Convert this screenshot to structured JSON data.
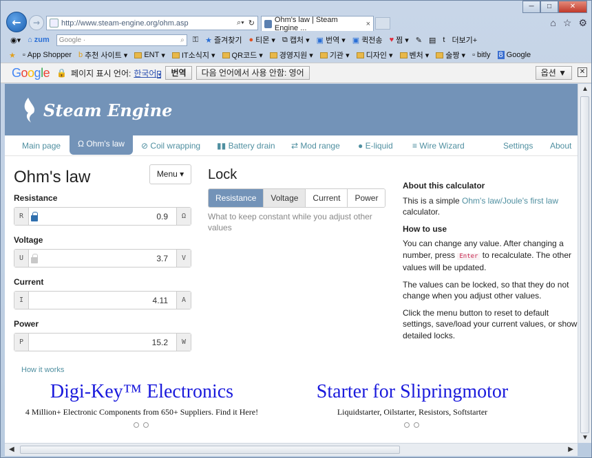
{
  "browser": {
    "url": "http://www.steam-engine.org/ohm.asp",
    "tab_title": "Ohm's law | Steam Engine ...",
    "tab_close": "×",
    "search_placeholder": "Google ·",
    "toolbar1": [
      "zum",
      "즐겨찾기",
      "티몬",
      "캡처",
      "번역",
      "퀵전송",
      "찜",
      "더보기+"
    ],
    "toolbar2": [
      "App Shopper",
      "추천 사이트",
      "ENT",
      "IT소식지",
      "QR코드",
      "경영지원",
      "기관",
      "디자인",
      "벤처",
      "술짱",
      "bitly",
      "Google"
    ]
  },
  "translate_bar": {
    "logo": "Google",
    "page_language_label": "페이지 표시 언어:",
    "page_language": "한국어",
    "translate_button": "번역",
    "never_button": "다음 언어에서 사용 안함: 영어",
    "options_button": "옵션 ▼",
    "close": "✕"
  },
  "site": {
    "brand": "Steam Engine",
    "nav": [
      "Main page",
      "Ohm's law",
      "Coil wrapping",
      "Battery drain",
      "Mod range",
      "E-liquid",
      "Wire Wizard",
      "Settings",
      "About"
    ],
    "nav_icons": [
      "",
      "Ω",
      "⊘",
      "▮▮",
      "⇄",
      "●",
      "≡",
      "",
      ""
    ]
  },
  "calculator": {
    "title": "Ohm's law",
    "menu_label": "Menu ▾",
    "fields": [
      {
        "label": "Resistance",
        "prefix": "R",
        "value": "0.9",
        "unit": "Ω",
        "locked": true
      },
      {
        "label": "Voltage",
        "prefix": "U",
        "value": "3.7",
        "unit": "V",
        "locked": false
      },
      {
        "label": "Current",
        "prefix": "I",
        "value": "4.11",
        "unit": "A",
        "locked": null
      },
      {
        "label": "Power",
        "prefix": "P",
        "value": "15.2",
        "unit": "W",
        "locked": null
      }
    ]
  },
  "lock": {
    "title": "Lock",
    "options": [
      "Resistance",
      "Voltage",
      "Current",
      "Power"
    ],
    "selected": "Resistance",
    "hint": "What to keep constant while you adjust other values"
  },
  "about": {
    "h1": "About this calculator",
    "p1a": "This is a simple ",
    "p1_link": "Ohm's law/Joule's first law",
    "p1b": " calculator.",
    "h2": "How to use",
    "p2a": "You can change any value. After changing a number, press ",
    "p2_key": "Enter",
    "p2b": " to recalculate. The other values will be updated.",
    "p3": "The values can be locked, so that they do not change when you adjust other values.",
    "p4": "Click the menu button to reset to default settings, save/load your current values, or show detailed locks."
  },
  "how_it_works": "How it works",
  "ads": [
    {
      "title": "Digi-Key™ Electronics",
      "desc": "4 Million+ Electronic Components from 650+ Suppliers. Find it Here!"
    },
    {
      "title": "Starter for Slipringmotor",
      "desc": "Liquidstarter, Oilstarter, Resistors, Softstarter"
    }
  ],
  "colors": {
    "header": "#7393b8",
    "link": "#4f8fa0",
    "ad_title": "#1a1adc"
  }
}
